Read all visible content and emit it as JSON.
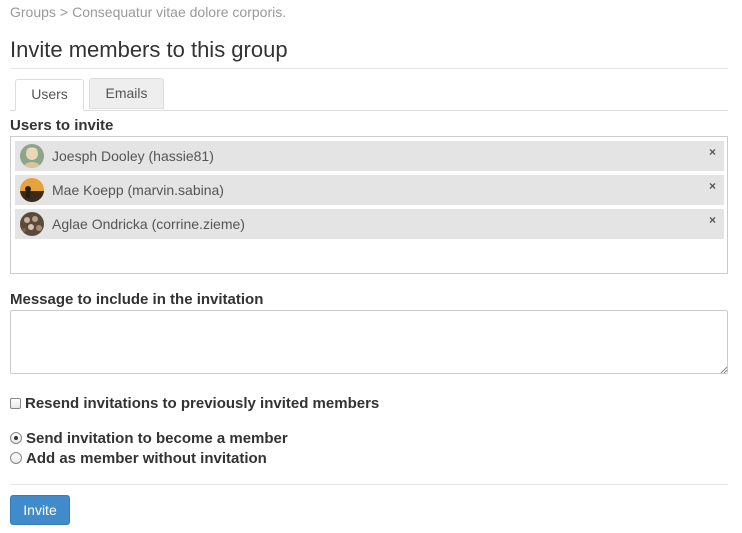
{
  "breadcrumb": {
    "root": "Groups",
    "separator": ">",
    "current": "Consequatur vitae dolore corporis."
  },
  "page_title": "Invite members to this group",
  "tabs": [
    {
      "label": "Users",
      "active": true
    },
    {
      "label": "Emails",
      "active": false
    }
  ],
  "users_section": {
    "label": "Users to invite",
    "selected_users": [
      {
        "name": "Joesph Dooley (hassie81)",
        "avatar_icon": "user-avatar-icon",
        "remove": "×"
      },
      {
        "name": "Mae Koepp (marvin.sabina)",
        "avatar_icon": "user-avatar-icon",
        "remove": "×"
      },
      {
        "name": "Aglae Ondricka (corrine.zieme)",
        "avatar_icon": "user-avatar-icon",
        "remove": "×"
      }
    ]
  },
  "message_section": {
    "label": "Message to include in the invitation",
    "value": ""
  },
  "resend_option": {
    "label": "Resend invitations to previously invited members",
    "checked": false
  },
  "membership_options": [
    {
      "label": "Send invitation to become a member",
      "checked": true
    },
    {
      "label": "Add as member without invitation",
      "checked": false
    }
  ],
  "invite_button": {
    "label": "Invite"
  },
  "colors": {
    "primary_button": "#428bca",
    "chip_background": "#e4e4e4",
    "breadcrumb_text": "#999999"
  }
}
